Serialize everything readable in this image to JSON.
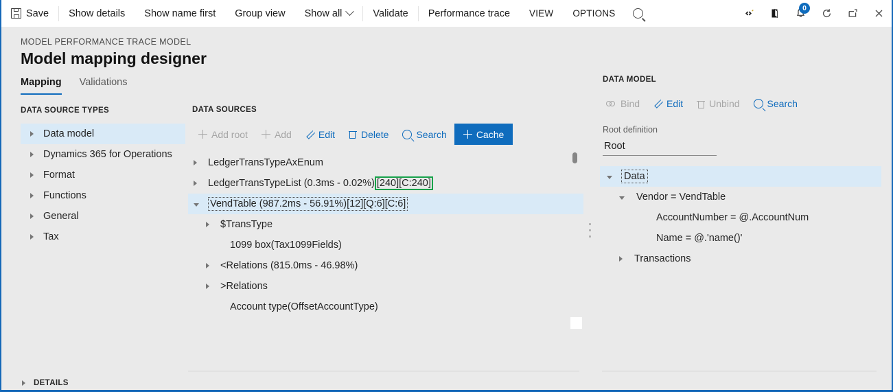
{
  "commandbar": {
    "items": [
      {
        "label": "Save",
        "icon": "save-icon",
        "name": "save-button"
      },
      {
        "label": "Show details",
        "icon": null,
        "name": "show-details-button"
      },
      {
        "label": "Show name first",
        "icon": null,
        "name": "show-name-first-button"
      },
      {
        "label": "Group view",
        "icon": null,
        "name": "group-view-button"
      },
      {
        "label": "Show all",
        "icon": "chevron-down-icon",
        "name": "show-all-button"
      },
      {
        "label": "Validate",
        "icon": null,
        "name": "validate-button"
      },
      {
        "label": "Performance trace",
        "icon": null,
        "name": "performance-trace-button"
      },
      {
        "label": "VIEW",
        "icon": null,
        "name": "view-menu"
      },
      {
        "label": "OPTIONS",
        "icon": null,
        "name": "options-menu"
      }
    ],
    "search_icon": "search-icon",
    "right_icons": [
      {
        "name": "settings-icon",
        "glyph": "❖"
      },
      {
        "name": "help-book-icon",
        "glyph": "◗"
      },
      {
        "name": "notifications-icon",
        "glyph": "⨁",
        "badge": "0"
      },
      {
        "name": "refresh-icon",
        "glyph": "↻"
      },
      {
        "name": "popout-icon",
        "glyph": "↗"
      },
      {
        "name": "close-icon",
        "glyph": "✕"
      }
    ]
  },
  "header": {
    "breadcrumb": "MODEL PERFORMANCE TRACE MODEL",
    "title": "Model mapping designer"
  },
  "tabs": [
    {
      "label": "Mapping",
      "active": true
    },
    {
      "label": "Validations",
      "active": false
    }
  ],
  "data_source_types": {
    "caption": "DATA SOURCE TYPES",
    "items": [
      {
        "label": "Data model",
        "selected": true,
        "expander": "collapsed"
      },
      {
        "label": "Dynamics 365 for Operations",
        "selected": false,
        "expander": "collapsed"
      },
      {
        "label": "Format",
        "selected": false,
        "expander": "collapsed"
      },
      {
        "label": "Functions",
        "selected": false,
        "expander": "collapsed"
      },
      {
        "label": "General",
        "selected": false,
        "expander": "collapsed"
      },
      {
        "label": "Tax",
        "selected": false,
        "expander": "collapsed"
      }
    ]
  },
  "data_sources": {
    "caption": "DATA SOURCES",
    "toolbar": [
      {
        "label": "Add root",
        "icon": "plus-icon",
        "disabled": true,
        "name": "add-root-button"
      },
      {
        "label": "Add",
        "icon": "plus-icon",
        "disabled": true,
        "name": "add-button"
      },
      {
        "label": "Edit",
        "icon": "pencil-icon",
        "disabled": false,
        "name": "edit-button"
      },
      {
        "label": "Delete",
        "icon": "trash-icon",
        "disabled": false,
        "name": "delete-button"
      },
      {
        "label": "Search",
        "icon": "search-icon",
        "disabled": false,
        "name": "search-button"
      },
      {
        "label": "Cache",
        "icon": "plus-icon",
        "disabled": false,
        "primary": true,
        "name": "cache-button"
      }
    ],
    "tree": [
      {
        "text": "LedgerTransTypeAxEnum",
        "indent": 0,
        "expander": "collapsed",
        "selected": false
      },
      {
        "text": "LedgerTransTypeList (0.3ms - 0.02%)",
        "highlight": "[240][C:240]",
        "indent": 0,
        "expander": "collapsed",
        "selected": false
      },
      {
        "text": "VendTable (987.2ms - 56.91%)[12][Q:6][C:6]",
        "indent": 0,
        "expander": "expanded",
        "selected": true,
        "focused": true
      },
      {
        "text": "$TransType",
        "indent": 1,
        "expander": "collapsed",
        "selected": false
      },
      {
        "text": "1099 box(Tax1099Fields)",
        "indent": 1,
        "expander": "none",
        "selected": false
      },
      {
        "text": "<Relations (815.0ms - 46.98%)",
        "indent": 1,
        "expander": "collapsed",
        "selected": false
      },
      {
        "text": ">Relations",
        "indent": 1,
        "expander": "collapsed",
        "selected": false
      },
      {
        "text": "Account type(OffsetAccountType)",
        "indent": 1,
        "expander": "none",
        "selected": false
      }
    ]
  },
  "data_model": {
    "caption": "DATA MODEL",
    "toolbar": [
      {
        "label": "Bind",
        "icon": "link-icon",
        "disabled": true,
        "name": "bind-button"
      },
      {
        "label": "Edit",
        "icon": "pencil-icon",
        "disabled": false,
        "name": "edit-binding-button"
      },
      {
        "label": "Unbind",
        "icon": "trash-icon",
        "disabled": true,
        "name": "unbind-button"
      },
      {
        "label": "Search",
        "icon": "search-icon",
        "disabled": false,
        "name": "search-model-button"
      }
    ],
    "root_definition_label": "Root definition",
    "root_definition_value": "Root",
    "tree": [
      {
        "text": "Data",
        "indent": 0,
        "expander": "expanded",
        "selected": true,
        "focused": true
      },
      {
        "text": "Vendor = VendTable",
        "indent": 1,
        "expander": "expanded",
        "selected": false
      },
      {
        "text": "AccountNumber = @.AccountNum",
        "indent": 2,
        "expander": "none",
        "selected": false
      },
      {
        "text": "Name = @.'name()'",
        "indent": 2,
        "expander": "none",
        "selected": false
      },
      {
        "text": "Transactions",
        "indent": 1,
        "expander": "collapsed",
        "selected": false
      }
    ]
  },
  "footer": {
    "details_label": "DETAILS"
  },
  "colors": {
    "accent": "#0f6cbd",
    "selection": "#d9eaf7",
    "highlight_green": "#17a24a",
    "page_bg": "#eaeaea",
    "bar_bg": "#ffffff"
  }
}
